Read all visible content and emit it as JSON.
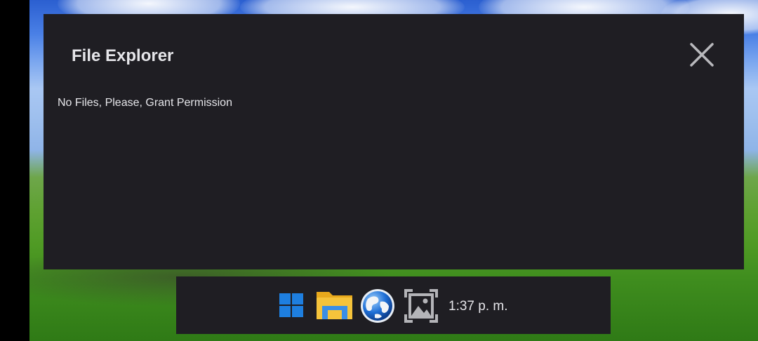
{
  "window": {
    "title": "File Explorer",
    "message": "No Files, Please, Grant Permission"
  },
  "taskbar": {
    "icons": [
      "start-icon",
      "file-explorer-icon",
      "browser-globe-icon",
      "gallery-icon"
    ],
    "time": "1:37 p. m."
  },
  "colors": {
    "window_bg": "#1f1e23",
    "text": "#e6e6ea",
    "start_blue": "#1e7fe0",
    "folder_yellow": "#f5c33b"
  }
}
